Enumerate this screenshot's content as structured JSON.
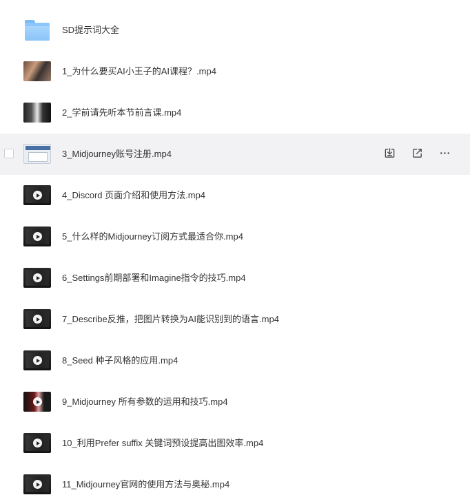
{
  "files": [
    {
      "name": "SD提示词大全",
      "type": "folder",
      "thumb": "folder-icon"
    },
    {
      "name": "1_为什么要买AI小王子的AI课程？.mp4",
      "type": "video",
      "thumb": "photo"
    },
    {
      "name": "2_学前请先听本节前言课.mp4",
      "type": "video",
      "thumb": "poster"
    },
    {
      "name": "3_Midjourney账号注册.mp4",
      "type": "video",
      "thumb": "screen",
      "hovered": true
    },
    {
      "name": "4_Discord 页面介绍和使用方法.mp4",
      "type": "video",
      "thumb": "dark"
    },
    {
      "name": "5_什么样的Midjourney订阅方式最适合你.mp4",
      "type": "video",
      "thumb": "dark"
    },
    {
      "name": "6_Settings前期部署和Imagine指令的技巧.mp4",
      "type": "video",
      "thumb": "dark"
    },
    {
      "name": "7_Describe反推，把图片转换为AI能识别到的语言.mp4",
      "type": "video",
      "thumb": "dark"
    },
    {
      "name": "8_Seed 种子风格的应用.mp4",
      "type": "video",
      "thumb": "dark"
    },
    {
      "name": "9_Midjourney 所有参数的运用和技巧.mp4",
      "type": "video",
      "thumb": "red"
    },
    {
      "name": "10_利用Prefer suffix 关键词预设提高出图效率.mp4",
      "type": "video",
      "thumb": "dark"
    },
    {
      "name": "11_Midjourney官网的使用方法与奥秘.mp4",
      "type": "video",
      "thumb": "dark"
    }
  ],
  "row_actions": [
    "download-icon",
    "share-icon",
    "more-icon"
  ]
}
